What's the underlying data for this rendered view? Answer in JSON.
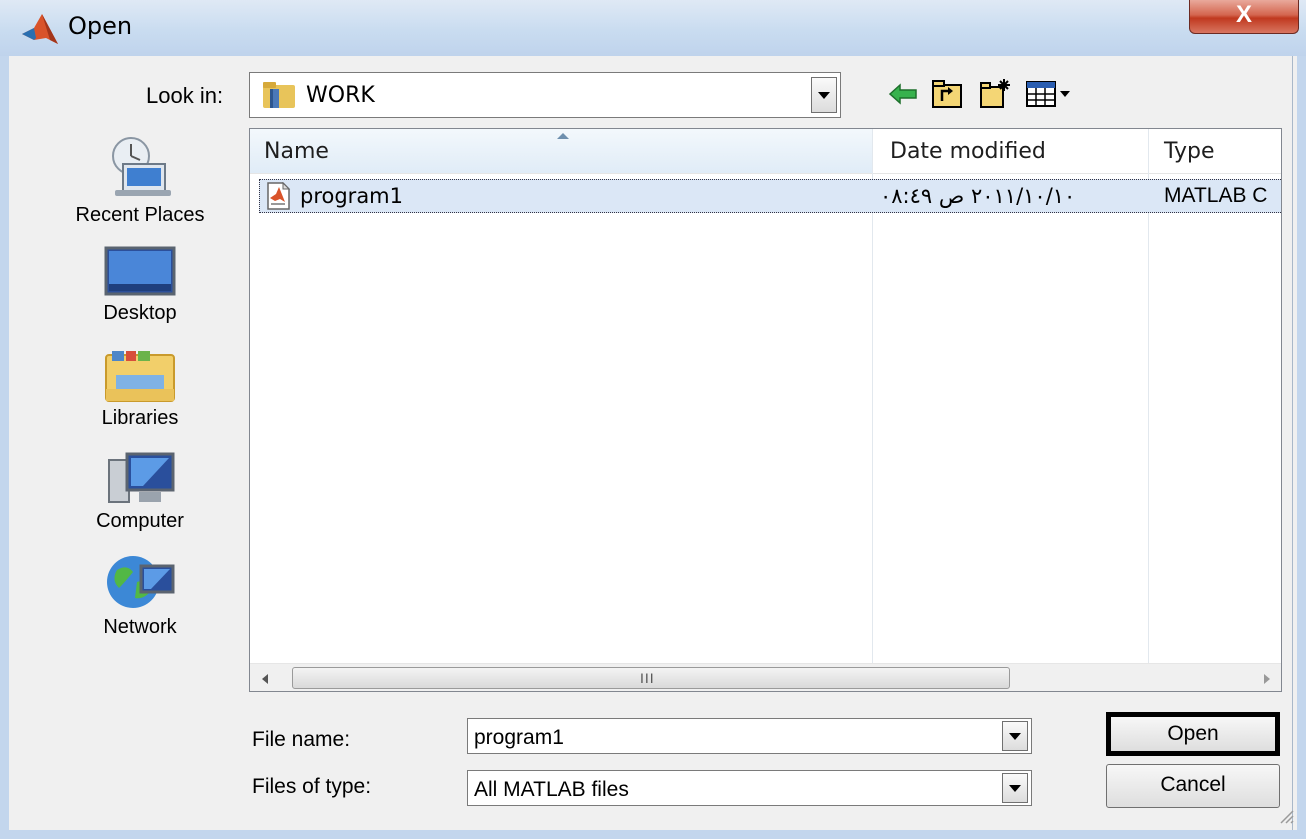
{
  "window": {
    "title": "Open",
    "close_label": "X"
  },
  "lookin": {
    "label": "Look in:",
    "value": "WORK"
  },
  "toolbar": {
    "icons": [
      "back-arrow-icon",
      "up-folder-icon",
      "new-folder-icon",
      "view-menu-icon"
    ]
  },
  "places": [
    {
      "label": "Recent Places",
      "icon": "recent-places-icon"
    },
    {
      "label": "Desktop",
      "icon": "desktop-icon"
    },
    {
      "label": "Libraries",
      "icon": "libraries-icon"
    },
    {
      "label": "Computer",
      "icon": "computer-icon"
    },
    {
      "label": "Network",
      "icon": "network-icon"
    }
  ],
  "filelist": {
    "columns": [
      "Name",
      "Date modified",
      "Type"
    ],
    "rows": [
      {
        "name": "program1",
        "date": "٢٠١١/١٠/١٠ ص ٠٨:٤٩",
        "type": "MATLAB C"
      }
    ],
    "scroll_grip": "III"
  },
  "filename": {
    "label": "File name:",
    "value": "program1"
  },
  "filetype": {
    "label": "Files of type:",
    "value": "All MATLAB files"
  },
  "buttons": {
    "open": "Open",
    "cancel": "Cancel"
  },
  "colors": {
    "titlebar": "#c9dcf0",
    "close_button": "#c0391f",
    "selection": "#dbe7f6"
  }
}
